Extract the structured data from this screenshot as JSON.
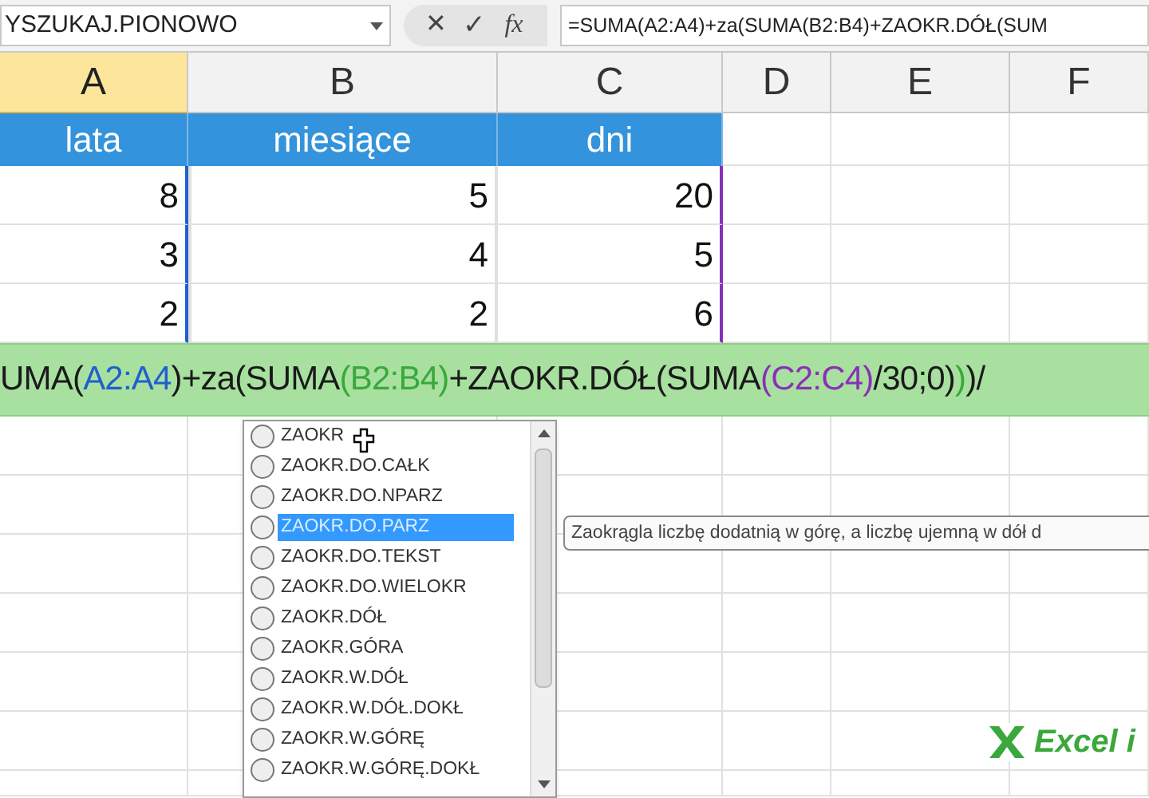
{
  "formula_bar": {
    "name_box": "YSZUKAJ.PIONOWO",
    "cancel": "✕",
    "enter": "✓",
    "function": "fx",
    "formula": "=SUMA(A2:A4)+za(SUMA(B2:B4)+ZAOKR.DÓŁ(SUM"
  },
  "columns": [
    {
      "label": "A",
      "selected": true
    },
    {
      "label": "B",
      "selected": false
    },
    {
      "label": "C",
      "selected": false
    },
    {
      "label": "D",
      "selected": false
    },
    {
      "label": "E",
      "selected": false
    },
    {
      "label": "F",
      "selected": false
    }
  ],
  "header_row": [
    "lata",
    "miesiące",
    "dni"
  ],
  "rows": [
    [
      "8",
      "5",
      "20"
    ],
    [
      "3",
      "4",
      "5"
    ],
    [
      "2",
      "2",
      "6"
    ]
  ],
  "edit_cell": [
    {
      "text": "UMA(",
      "color": "#1a1a1a"
    },
    {
      "text": "A2:A4",
      "color": "#1f5fd0"
    },
    {
      "text": ")+za",
      "color": "#1a1a1a"
    },
    {
      "text": "(SUMA",
      "color": "#1a1a1a"
    },
    {
      "text": "(",
      "color": "#3aa83a"
    },
    {
      "text": "B2:B4",
      "color": "#3aa83a"
    },
    {
      "text": ")",
      "color": "#3aa83a"
    },
    {
      "text": "+ZAOKR.DÓŁ(SUMA",
      "color": "#1a1a1a"
    },
    {
      "text": "(",
      "color": "#8a2fb8"
    },
    {
      "text": "C2:C4",
      "color": "#8a2fb8"
    },
    {
      "text": ")",
      "color": "#8a2fb8"
    },
    {
      "text": "/30;0)",
      "color": "#1a1a1a"
    },
    {
      "text": ")",
      "color": "#3aa83a"
    },
    {
      "text": ")/",
      "color": "#1a1a1a"
    }
  ],
  "autocomplete": [
    {
      "label": "ZAOKR",
      "selected": false
    },
    {
      "label": "ZAOKR.DO.CAŁK",
      "selected": false
    },
    {
      "label": "ZAOKR.DO.NPARZ",
      "selected": false
    },
    {
      "label": "ZAOKR.DO.PARZ",
      "selected": true
    },
    {
      "label": "ZAOKR.DO.TEKST",
      "selected": false
    },
    {
      "label": "ZAOKR.DO.WIELOKR",
      "selected": false
    },
    {
      "label": "ZAOKR.DÓŁ",
      "selected": false
    },
    {
      "label": "ZAOKR.GÓRA",
      "selected": false
    },
    {
      "label": "ZAOKR.W.DÓŁ",
      "selected": false
    },
    {
      "label": "ZAOKR.W.DÓŁ.DOKŁ",
      "selected": false
    },
    {
      "label": "ZAOKR.W.GÓRĘ",
      "selected": false
    },
    {
      "label": "ZAOKR.W.GÓRĘ.DOKŁ",
      "selected": false
    }
  ],
  "tooltip": "Zaokrągla liczbę dodatnią w górę, a liczbę ujemną w dół d",
  "watermark_logo": "Excel i"
}
